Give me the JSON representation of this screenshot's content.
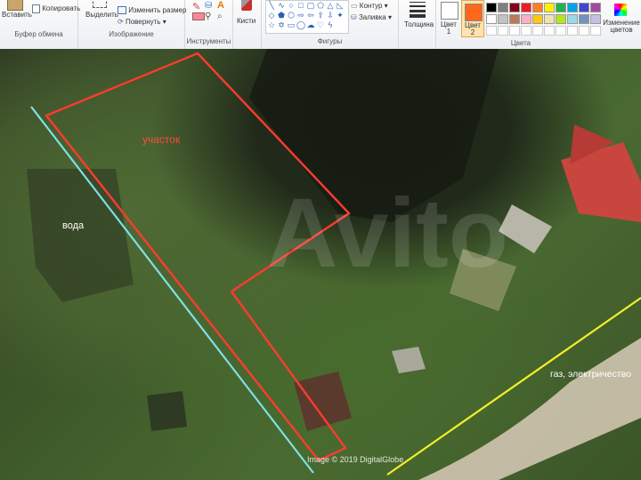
{
  "ribbon": {
    "clipboard": {
      "paste_label": "Вставить",
      "copy_label": "Копировать",
      "group_label": "Буфер обмена"
    },
    "image": {
      "select_label": "Выделить",
      "resize_label": "Изменить размер",
      "rotate_label": "Повернуть",
      "group_label": "Изображение"
    },
    "tools": {
      "group_label": "Инструменты"
    },
    "brushes": {
      "label": "Кисти"
    },
    "shapes": {
      "outline_label": "Контур",
      "fill_label": "Заливка",
      "group_label": "Фигуры"
    },
    "size": {
      "label": "Толщина"
    },
    "colors": {
      "color1_label": "Цвет 1",
      "color2_label": "Цвет 2",
      "edit_colors_label": "Изменение цветов",
      "group_label": "Цвета",
      "color2_value": "#ff6a1a",
      "palette_row1": [
        "#000000",
        "#7f7f7f",
        "#880015",
        "#ed1c24",
        "#ff7f27",
        "#fff200",
        "#22b14c",
        "#00a2e8",
        "#3f48cc",
        "#a349a4"
      ],
      "palette_row2": [
        "#ffffff",
        "#c3c3c3",
        "#b97a57",
        "#ffaec9",
        "#ffc90e",
        "#efe4b0",
        "#b5e61d",
        "#99d9ea",
        "#7092be",
        "#c8bfe7"
      ]
    }
  },
  "map": {
    "plot_label": "участок",
    "water_label": "вода",
    "utilities_label": "газ, электричество",
    "watermark": "Avito",
    "credit": "Image © 2019 DigitalGlobe",
    "plot_color": "#ff3b2f",
    "water_line_color": "#7fe0e6",
    "utilities_line_color": "#f2ee2a"
  }
}
